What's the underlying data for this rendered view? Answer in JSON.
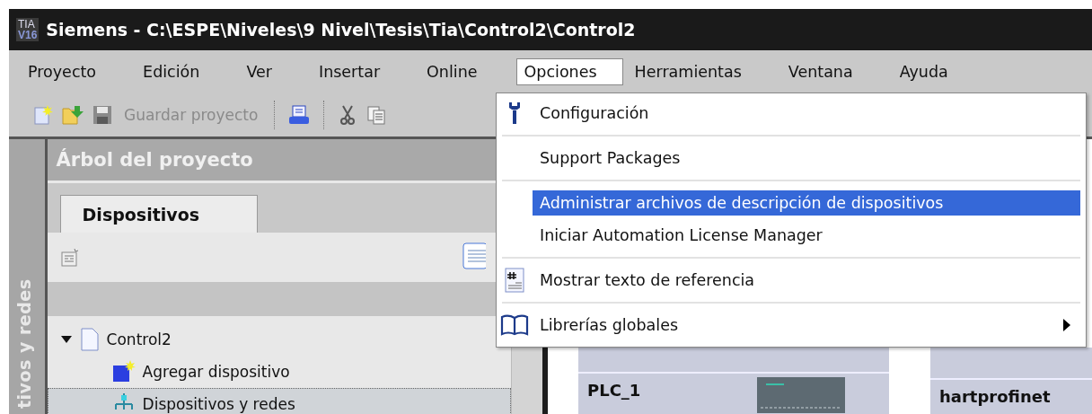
{
  "window": {
    "logo": [
      "TIA",
      "V16"
    ],
    "title": "Siemens - C:\\ESPE\\Niveles\\9 Nivel\\Tesis\\Tia\\Control2\\Control2"
  },
  "menu": [
    {
      "label": "Proyecto",
      "selected": false
    },
    {
      "label": "Edición",
      "selected": false
    },
    {
      "label": "Ver",
      "selected": false
    },
    {
      "label": "Insertar",
      "selected": false
    },
    {
      "label": "Online",
      "selected": false
    },
    {
      "label": "Opciones",
      "selected": true
    },
    {
      "label": "Herramientas",
      "selected": false
    },
    {
      "label": "Ventana",
      "selected": false
    },
    {
      "label": "Ayuda",
      "selected": false
    }
  ],
  "toolbar": {
    "save_label": "Guardar proyecto",
    "save_disabled": true
  },
  "dropdown": [
    {
      "kind": "item",
      "label": "Configuración",
      "selected": false
    },
    {
      "kind": "separator"
    },
    {
      "kind": "item",
      "label": "Support Packages",
      "selected": false
    },
    {
      "kind": "separator"
    },
    {
      "kind": "item",
      "label": "Administrar archivos de descripción de dispositivos",
      "selected": true
    },
    {
      "kind": "item",
      "label": "Iniciar Automation License Manager",
      "selected": false
    },
    {
      "kind": "separator"
    },
    {
      "kind": "item",
      "label": "Mostrar texto de referencia",
      "selected": false
    },
    {
      "kind": "separator"
    },
    {
      "kind": "submenu",
      "label": "Librerías globales",
      "selected": false
    }
  ],
  "side_tab": "tivos y redes",
  "project_tree": {
    "title": "Árbol del proyecto",
    "tabs": [
      {
        "label": "Dispositivos",
        "selected": true
      }
    ],
    "items": [
      {
        "label": "Control2",
        "expanded": true,
        "children": [
          {
            "label": "Agregar dispositivo",
            "selected": false
          },
          {
            "label": "Dispositivos y redes",
            "selected": true
          }
        ]
      }
    ]
  },
  "devices": [
    {
      "name": "PLC_1"
    },
    {
      "name": "hartprofinet"
    }
  ]
}
